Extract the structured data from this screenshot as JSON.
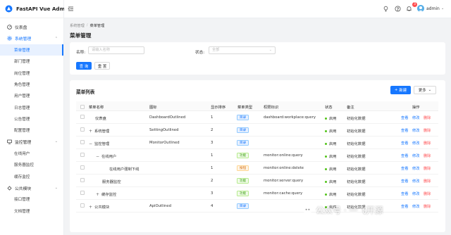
{
  "app": {
    "title": "FastAPI Vue Admin"
  },
  "sidebar": {
    "items": [
      {
        "type": "item",
        "label": "仪表盘",
        "icon": "dashboard-icon"
      },
      {
        "type": "group",
        "label": "系统管理",
        "icon": "setting-icon",
        "open": true
      },
      {
        "type": "sub",
        "label": "菜单管理",
        "active": true
      },
      {
        "type": "sub",
        "label": "部门管理"
      },
      {
        "type": "sub",
        "label": "岗位管理"
      },
      {
        "type": "sub",
        "label": "角色管理"
      },
      {
        "type": "sub",
        "label": "用户管理"
      },
      {
        "type": "sub",
        "label": "日志管理"
      },
      {
        "type": "sub",
        "label": "公告管理"
      },
      {
        "type": "sub",
        "label": "配置管理"
      },
      {
        "type": "group",
        "label": "监控管理",
        "icon": "monitor-icon"
      },
      {
        "type": "sub",
        "label": "在线用户"
      },
      {
        "type": "sub",
        "label": "服务器监控"
      },
      {
        "type": "sub",
        "label": "缓存监控"
      },
      {
        "type": "group",
        "label": "公共模块",
        "icon": "api-icon"
      },
      {
        "type": "sub",
        "label": "接口管理"
      },
      {
        "type": "sub",
        "label": "文档管理"
      }
    ]
  },
  "header": {
    "notification_count": "3",
    "user_name": "admin"
  },
  "breadcrumb": [
    "系统管理",
    "菜单管理"
  ],
  "page_title": "菜单管理",
  "search": {
    "name_label": "名称:",
    "name_placeholder": "请输入名称",
    "status_label": "状态:",
    "status_placeholder": "全部",
    "query_button": "查 询",
    "reset_button": "重 置"
  },
  "table": {
    "title": "菜单列表",
    "new_button": "新建",
    "more_button": "更多",
    "columns": [
      "菜单名称",
      "图标",
      "显示排序",
      "菜单类型",
      "权限标识",
      "状态",
      "备注",
      "操作"
    ],
    "rows": [
      {
        "name": "仪表盘",
        "expand": "",
        "indent": 0,
        "icon": "DashboardOutlined",
        "order": "1",
        "type": "目录",
        "type_color": "blue",
        "perm": "dashboard:workplace:query",
        "status": "启用",
        "remark": "初始化数据"
      },
      {
        "name": "系统管理",
        "expand": "+",
        "indent": 0,
        "icon": "SettingOutlined",
        "order": "2",
        "type": "目录",
        "type_color": "blue",
        "perm": "",
        "status": "启用",
        "remark": "初始化数据"
      },
      {
        "name": "监控管理",
        "expand": "−",
        "indent": 0,
        "icon": "MonitorOutlined",
        "order": "3",
        "type": "目录",
        "type_color": "blue",
        "perm": "",
        "status": "启用",
        "remark": "初始化数据"
      },
      {
        "name": "在线用户",
        "expand": "−",
        "indent": 1,
        "icon": "",
        "order": "1",
        "type": "功能",
        "type_color": "green",
        "perm": "monitor:online:query",
        "status": "启用",
        "remark": "初始化数据"
      },
      {
        "name": "在线用户强制下线",
        "expand": "",
        "indent": 2,
        "icon": "",
        "order": "1",
        "type": "按钮",
        "type_color": "orange",
        "perm": "monitor:online:delete",
        "status": "启用",
        "remark": "初始化数据"
      },
      {
        "name": "服务器监控",
        "expand": "",
        "indent": 1,
        "icon": "",
        "order": "2",
        "type": "功能",
        "type_color": "green",
        "perm": "monitor:server:query",
        "status": "启用",
        "remark": "初始化数据"
      },
      {
        "name": "缓存监控",
        "expand": "+",
        "indent": 1,
        "icon": "",
        "order": "3",
        "type": "功能",
        "type_color": "green",
        "perm": "monitor:cache:query",
        "status": "启用",
        "remark": "初始化数据"
      },
      {
        "name": "公共模块",
        "expand": "+",
        "indent": 0,
        "icon": "ApiOutlined",
        "order": "4",
        "type": "目录",
        "type_color": "blue",
        "perm": "",
        "status": "启用",
        "remark": "初始化数据"
      }
    ],
    "row_actions": [
      "查看",
      "修改",
      "删除"
    ]
  },
  "watermark": {
    "text": "公众号 · 一飞开源"
  },
  "colors": {
    "primary": "#1677ff",
    "danger": "#ff4d4f",
    "success": "#52c41a"
  }
}
